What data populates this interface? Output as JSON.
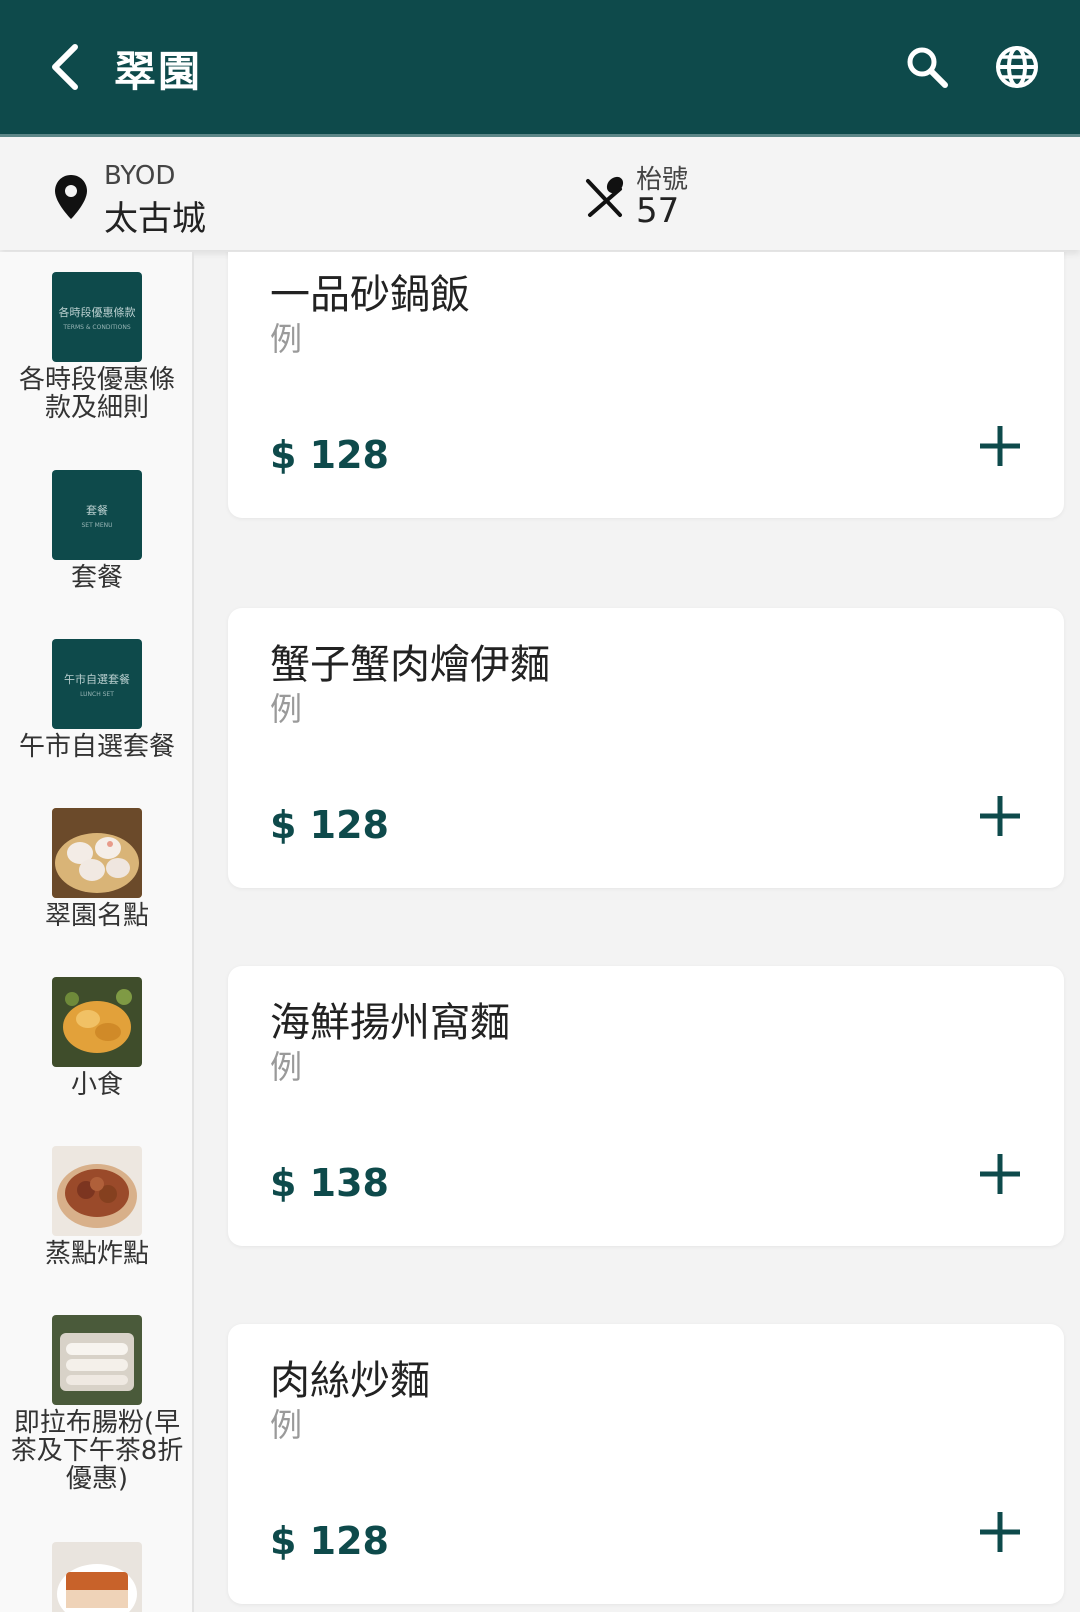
{
  "header": {
    "title": "翠園",
    "back_icon": "chevron-left-icon",
    "search_icon": "search-icon",
    "language_icon": "globe-icon"
  },
  "info": {
    "location_label": "BYOD",
    "location_name": "太古城",
    "table_label": "枱號",
    "table_number": "57"
  },
  "sidebar": {
    "items": [
      {
        "label": "各時段優惠條款及細則",
        "thumb_title": "各時段優惠條款",
        "thumb_sub": "TERMS & CONDITIONS"
      },
      {
        "label": "套餐",
        "thumb_title": "套餐",
        "thumb_sub": "SET MENU"
      },
      {
        "label": "午市自選套餐",
        "thumb_title": "午市自選套餐",
        "thumb_sub": "LUNCH SET"
      },
      {
        "label": "翠園名點"
      },
      {
        "label": "小食"
      },
      {
        "label": "蒸點炸點"
      },
      {
        "label": "即拉布腸粉(早茶及下午茶8折優惠)"
      },
      {
        "label": ""
      }
    ]
  },
  "menu": {
    "items": [
      {
        "name": "一品砂鍋飯",
        "unit": "例",
        "price": "$ 128"
      },
      {
        "name": "蟹子蟹肉燴伊麵",
        "unit": "例",
        "price": "$ 128"
      },
      {
        "name": "海鮮揚州窩麵",
        "unit": "例",
        "price": "$ 138"
      },
      {
        "name": "肉絲炒麵",
        "unit": "例",
        "price": "$ 128"
      }
    ]
  },
  "colors": {
    "primary": "#0e4a4b",
    "background": "#f3f3f3"
  }
}
